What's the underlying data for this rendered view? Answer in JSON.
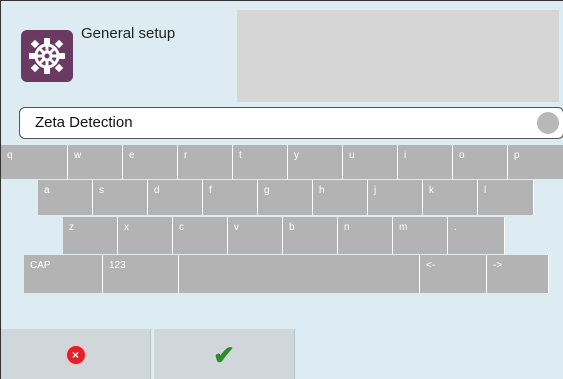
{
  "header": {
    "title": "General setup",
    "icon": "gear-icon",
    "icon_color": "#6b3a63"
  },
  "input": {
    "value": "Zeta Detection",
    "clear_icon": "clear-icon"
  },
  "keyboard": {
    "row1": [
      "q",
      "w",
      "e",
      "r",
      "t",
      "y",
      "u",
      "i",
      "o",
      "p"
    ],
    "row2": [
      "a",
      "s",
      "d",
      "f",
      "g",
      "h",
      "j",
      "k",
      "l"
    ],
    "row3": [
      "z",
      "x",
      "c",
      "v",
      "b",
      "n",
      "m",
      "."
    ],
    "row4": [
      "CAP",
      "123",
      "",
      "<-",
      "->"
    ]
  },
  "footer": {
    "cancel_icon": "cancel-icon",
    "cancel_symbol": "×",
    "confirm_icon": "checkmark-icon",
    "confirm_symbol": "✔"
  }
}
